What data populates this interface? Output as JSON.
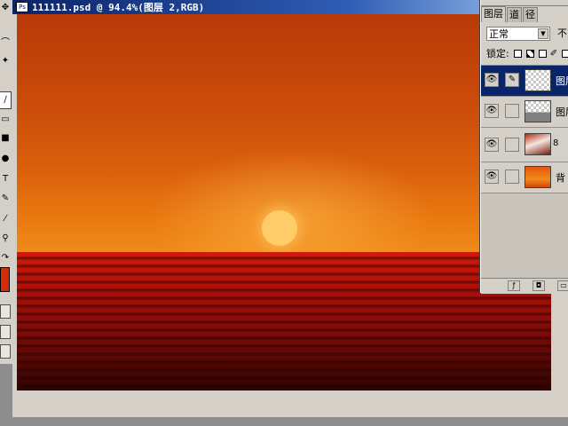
{
  "document": {
    "title": "111111.psd @ 94.4%(图层 2,RGB)"
  },
  "toolbox": {
    "tools": [
      {
        "name": "move-tool-icon",
        "glyph": "✥"
      },
      {
        "name": "lasso-tool-icon",
        "glyph": "⌒"
      },
      {
        "name": "magic-wand-tool-icon",
        "glyph": "✦"
      },
      {
        "name": "brush-tool-icon",
        "glyph": "∕"
      },
      {
        "name": "eraser-tool-icon",
        "glyph": "▭"
      },
      {
        "name": "gradient-tool-icon",
        "glyph": "■"
      },
      {
        "name": "dodge-tool-icon",
        "glyph": "●"
      },
      {
        "name": "type-tool-icon",
        "glyph": "T"
      },
      {
        "name": "pen-tool-icon",
        "glyph": "✎"
      },
      {
        "name": "eyedropper-tool-icon",
        "glyph": "⁄"
      },
      {
        "name": "zoom-tool-icon",
        "glyph": "⚲"
      },
      {
        "name": "swap-colors-icon",
        "glyph": "↷"
      }
    ],
    "foreground_color": "#d42c08"
  },
  "layers_panel": {
    "tabs": [
      {
        "label": "图层"
      },
      {
        "label": "道"
      },
      {
        "label": "径"
      }
    ],
    "blend_mode": "正常",
    "opacity_label": "不",
    "lock_label": "锁定:",
    "layers": [
      {
        "name": "图层",
        "thumb": "checker",
        "selected": true,
        "brush": "✎"
      },
      {
        "name": "图层",
        "thumb": "checker-sea",
        "selected": false
      },
      {
        "name": "",
        "thumb": "mask",
        "selected": false
      },
      {
        "name": "背",
        "thumb": "sunset",
        "selected": false
      }
    ]
  },
  "colors": {
    "titlebar": "#0a246a",
    "panel": "#d4d0c8",
    "sun": "#ffcc6a",
    "sea": "#b01008"
  }
}
